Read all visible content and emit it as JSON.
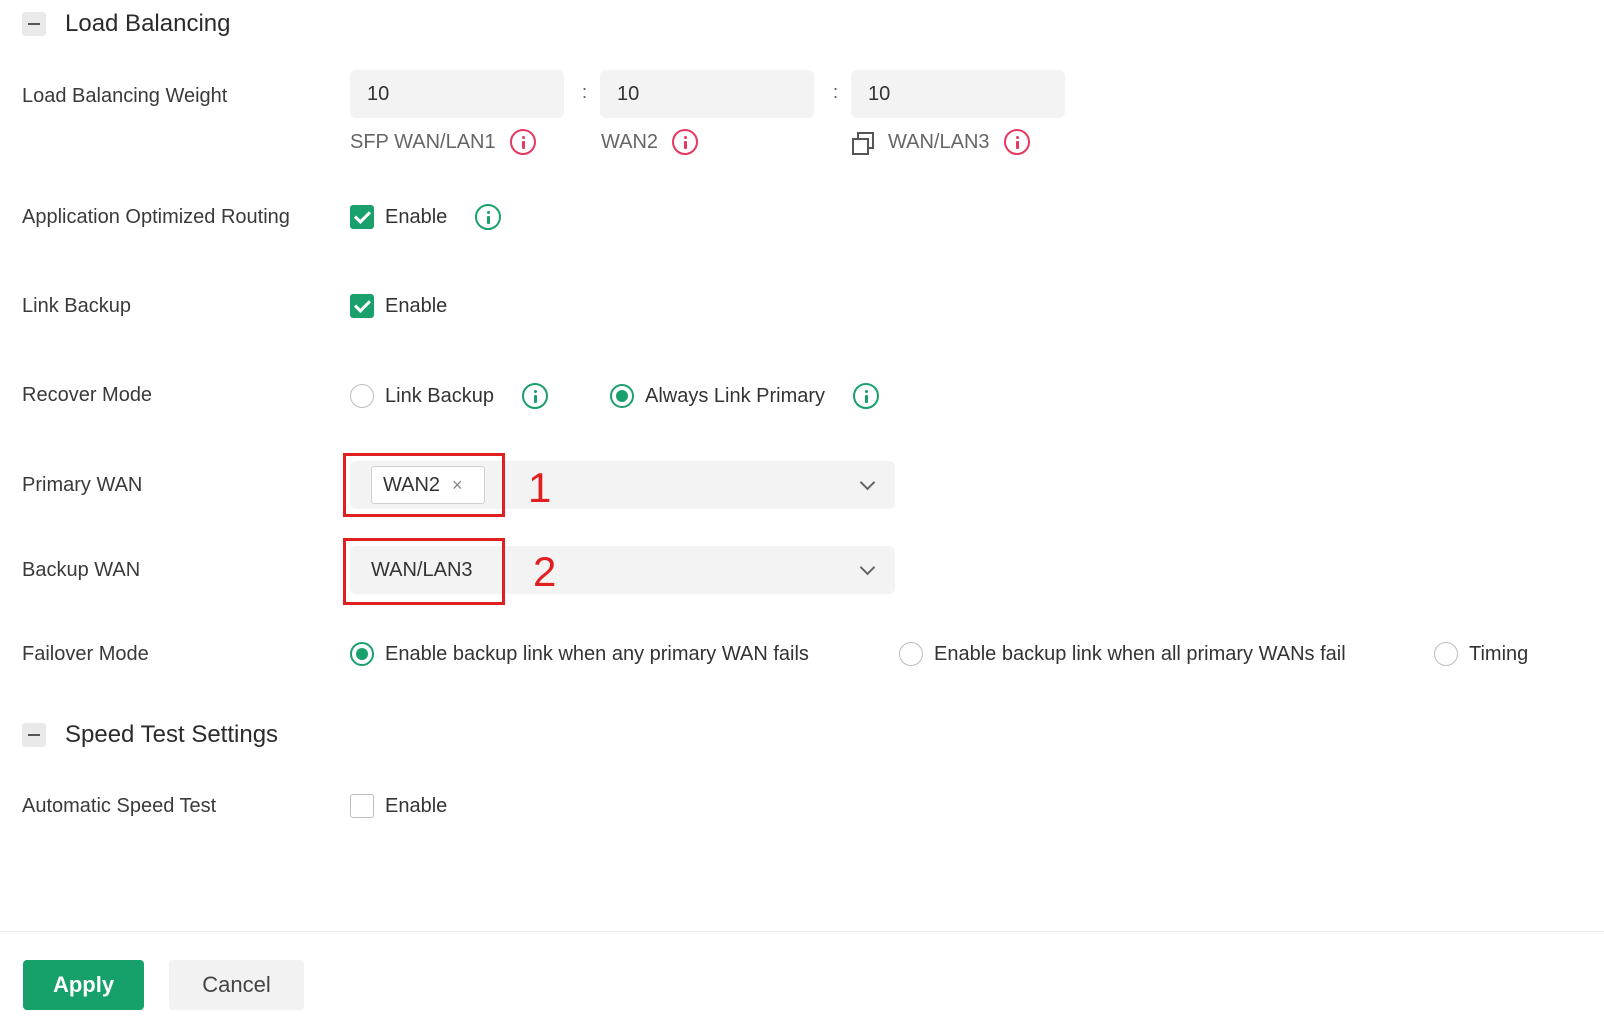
{
  "sections": {
    "load_balancing": {
      "title": "Load Balancing"
    },
    "speed_test": {
      "title": "Speed Test Settings"
    }
  },
  "load_balancing_weight": {
    "label": "Load Balancing Weight",
    "separator": ":",
    "inputs": [
      {
        "value": "10",
        "caption": "SFP WAN/LAN1"
      },
      {
        "value": "10",
        "caption": "WAN2"
      },
      {
        "value": "10",
        "caption": "WAN/LAN3"
      }
    ]
  },
  "app_optimized_routing": {
    "label": "Application Optimized Routing",
    "checkbox_label": "Enable",
    "checked": true
  },
  "link_backup": {
    "label": "Link Backup",
    "checkbox_label": "Enable",
    "checked": true
  },
  "recover_mode": {
    "label": "Recover Mode",
    "options": [
      {
        "label": "Link Backup",
        "selected": false
      },
      {
        "label": "Always Link Primary",
        "selected": true
      }
    ]
  },
  "primary_wan": {
    "label": "Primary WAN",
    "selected_tag": "WAN2",
    "remove_glyph": "×",
    "annotation": "1"
  },
  "backup_wan": {
    "label": "Backup WAN",
    "value": "WAN/LAN3",
    "annotation": "2"
  },
  "failover_mode": {
    "label": "Failover Mode",
    "options": [
      {
        "label": "Enable backup link when any primary WAN fails",
        "selected": true
      },
      {
        "label": "Enable backup link when all primary WANs fail",
        "selected": false
      },
      {
        "label": "Timing",
        "selected": false
      }
    ]
  },
  "automatic_speed_test": {
    "label": "Automatic Speed Test",
    "checkbox_label": "Enable",
    "checked": false
  },
  "footer": {
    "apply_label": "Apply",
    "cancel_label": "Cancel"
  },
  "colors": {
    "accent": "#16a06a",
    "info_red": "#e5395f",
    "annotation_red": "#e02020"
  }
}
